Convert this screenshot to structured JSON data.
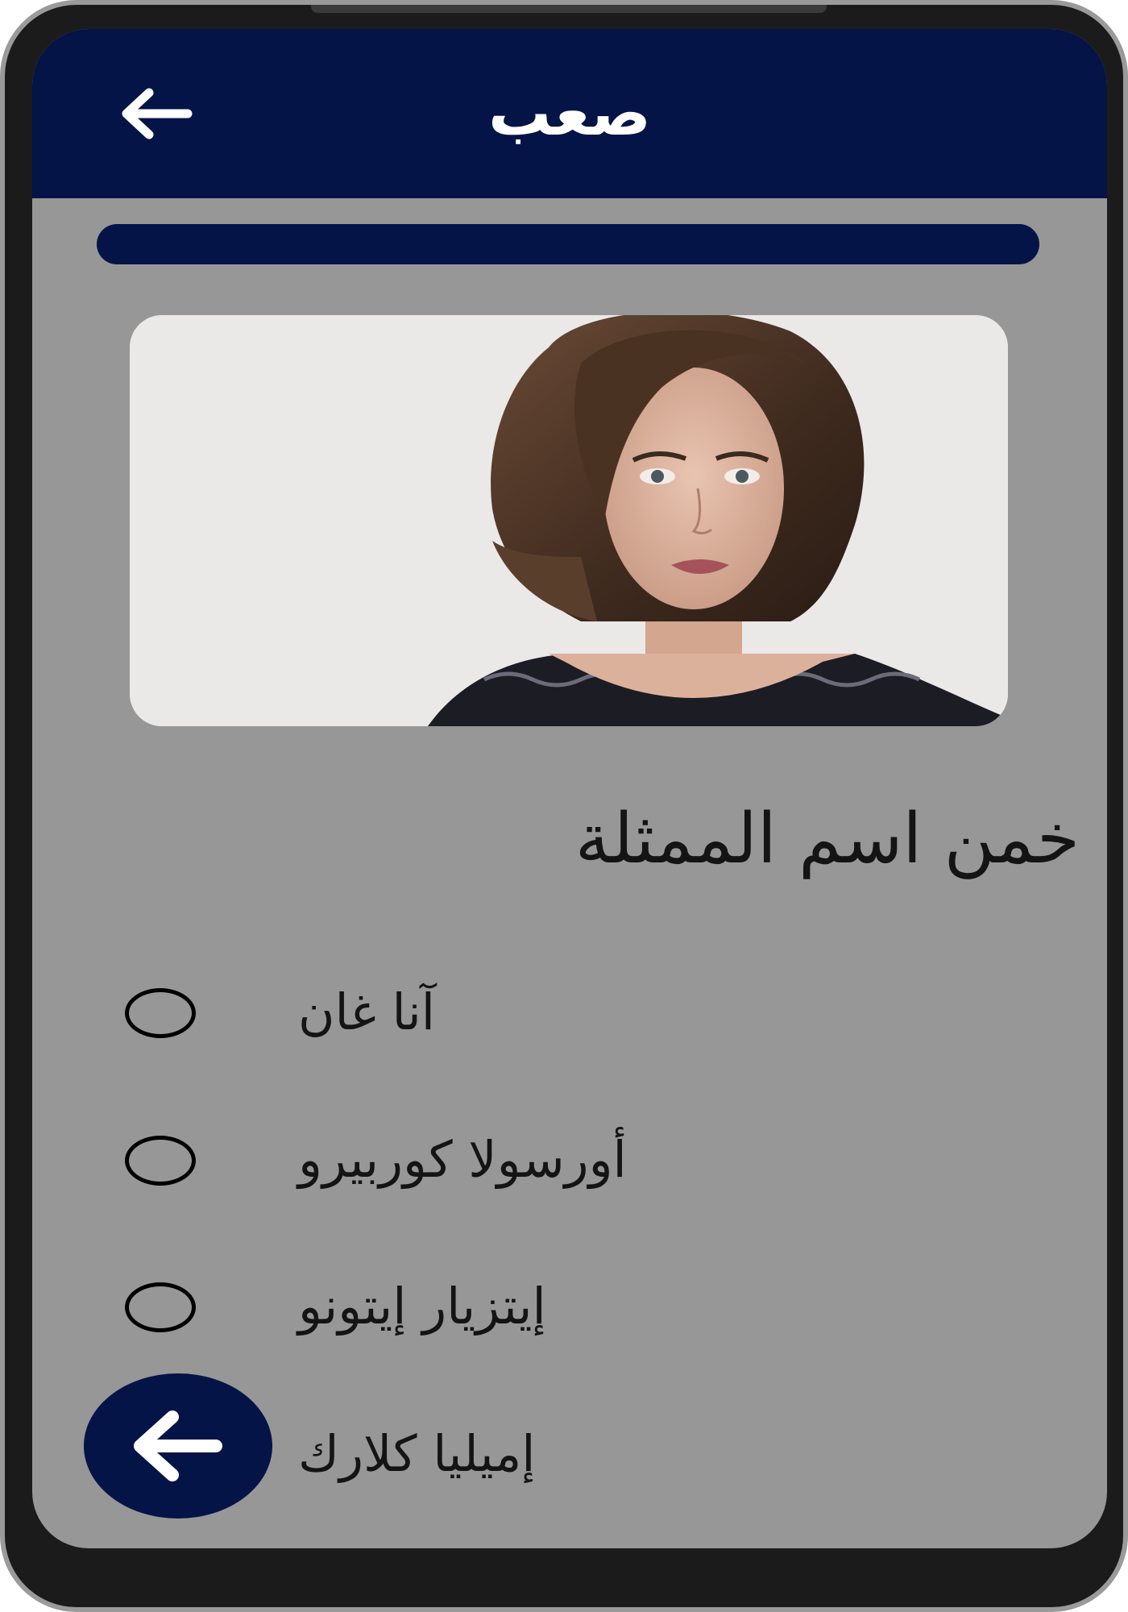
{
  "app_bar": {
    "title": "صعب",
    "back_icon": "arrow-left-icon"
  },
  "progress": {
    "value": 1.0
  },
  "question": "خمن اسم الممثلة",
  "photo": {
    "icon": "actress-photo"
  },
  "options": [
    {
      "label": "آنا غان",
      "selected": false
    },
    {
      "label": "أورسولا كوربيرو",
      "selected": false
    },
    {
      "label": "إيتزيار إيتونو",
      "selected": false
    },
    {
      "label": "إميليا كلارك",
      "selected": false
    }
  ],
  "fab": {
    "icon": "arrow-left-icon"
  },
  "colors": {
    "primary": "#041447",
    "background": "#979797",
    "text": "#141414"
  }
}
